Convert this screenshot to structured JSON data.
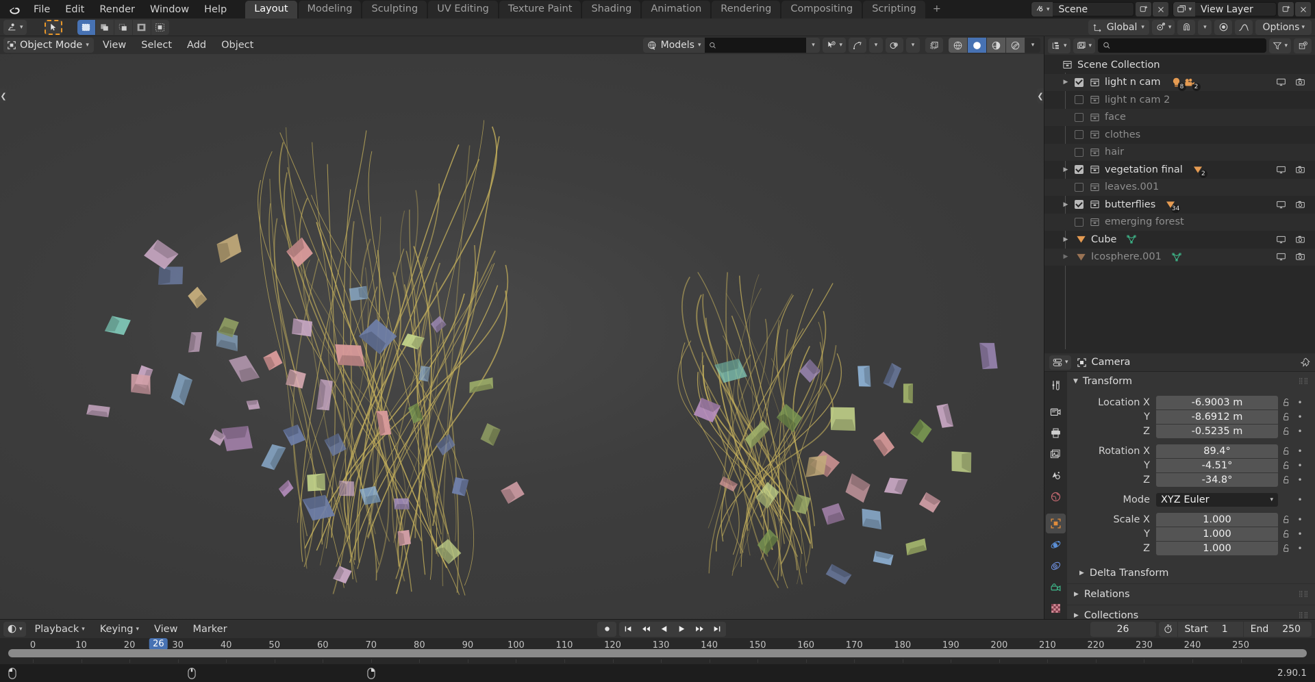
{
  "app": {
    "version": "2.90.1",
    "logo_icon": "blender-logo-icon"
  },
  "topbar": {
    "menus": [
      "File",
      "Edit",
      "Render",
      "Window",
      "Help"
    ],
    "workspace_tabs": [
      {
        "label": "Layout",
        "active": true
      },
      {
        "label": "Modeling",
        "active": false
      },
      {
        "label": "Sculpting",
        "active": false
      },
      {
        "label": "UV Editing",
        "active": false
      },
      {
        "label": "Texture Paint",
        "active": false
      },
      {
        "label": "Shading",
        "active": false
      },
      {
        "label": "Animation",
        "active": false
      },
      {
        "label": "Rendering",
        "active": false
      },
      {
        "label": "Compositing",
        "active": false
      },
      {
        "label": "Scripting",
        "active": false
      }
    ],
    "add_workspace_label": "+",
    "scene_name": "Scene",
    "view_layer_name": "View Layer"
  },
  "toolrow": {
    "transform_orientation": "Global",
    "options_label": "Options",
    "snapping_icon": "magnet-icon",
    "proportional_icon": "proportional-edit-icon",
    "editor_type_icon": "editor-type-icon",
    "cursor_tool_icon": "cursor-tool-icon",
    "select_modes": [
      "set",
      "extend",
      "subtract",
      "invert",
      "intersect"
    ]
  },
  "viewport_header": {
    "mode": "Object Mode",
    "menus": [
      "View",
      "Select",
      "Add",
      "Object"
    ],
    "collection_filter": "Models",
    "search_placeholder": "",
    "visibility_icon": "eye-visibility-icon",
    "gizmo_icon": "gizmo-icon",
    "overlays_icon": "overlays-icon",
    "xray_icon": "xray-toggle-icon",
    "shading_modes": [
      "wireframe",
      "solid",
      "material-preview",
      "rendered"
    ],
    "active_shading": "solid"
  },
  "outliner": {
    "display_mode_icon": "outliner-display-mode-icon",
    "filter_id_icon": "id-type-filter-icon",
    "search_placeholder": "",
    "filter_icon": "funnel-filter-icon",
    "new_collection_icon": "new-collection-icon",
    "root": "Scene Collection",
    "items": [
      {
        "name": "light n cam",
        "type": "collection",
        "checked": true,
        "dim": false,
        "expandable": true,
        "badges": [
          {
            "icon": "light-icon",
            "count": "8"
          },
          {
            "icon": "camera-icon",
            "count": "2"
          }
        ],
        "show_monitor": true,
        "show_camera": true
      },
      {
        "name": "light n cam 2",
        "type": "collection",
        "checked": false,
        "dim": true,
        "expandable": false,
        "badges": [],
        "show_monitor": false,
        "show_camera": false
      },
      {
        "name": "face",
        "type": "collection",
        "checked": false,
        "dim": true,
        "expandable": false,
        "badges": [],
        "show_monitor": false,
        "show_camera": false
      },
      {
        "name": "clothes",
        "type": "collection",
        "checked": false,
        "dim": true,
        "expandable": false,
        "badges": [],
        "show_monitor": false,
        "show_camera": false
      },
      {
        "name": "hair",
        "type": "collection",
        "checked": false,
        "dim": true,
        "expandable": false,
        "badges": [],
        "show_monitor": false,
        "show_camera": false
      },
      {
        "name": "vegetation final",
        "type": "collection",
        "checked": true,
        "dim": false,
        "expandable": true,
        "badges": [
          {
            "icon": "mesh-data-icon",
            "count": "2"
          }
        ],
        "show_monitor": true,
        "show_camera": true
      },
      {
        "name": "leaves.001",
        "type": "collection",
        "checked": false,
        "dim": true,
        "expandable": false,
        "badges": [],
        "show_monitor": false,
        "show_camera": false
      },
      {
        "name": "butterflies",
        "type": "collection",
        "checked": true,
        "dim": false,
        "expandable": true,
        "badges": [
          {
            "icon": "mesh-data-icon",
            "count": "34"
          }
        ],
        "show_monitor": true,
        "show_camera": true
      },
      {
        "name": "emerging forest",
        "type": "collection",
        "checked": false,
        "dim": true,
        "expandable": false,
        "badges": [],
        "show_monitor": false,
        "show_camera": false
      },
      {
        "name": "Cube",
        "type": "object",
        "checked": null,
        "dim": false,
        "expandable": true,
        "badges": [
          {
            "icon": "mesh-data-icon",
            "count": ""
          }
        ],
        "show_monitor": true,
        "show_camera": true
      },
      {
        "name": "Icosphere.001",
        "type": "object",
        "checked": null,
        "dim": true,
        "expandable": true,
        "badges": [
          {
            "icon": "mesh-data-icon",
            "count": ""
          }
        ],
        "show_monitor": true,
        "show_camera": true
      }
    ]
  },
  "properties": {
    "breadcrumb_object": "Camera",
    "pin_icon": "pin-icon",
    "tabs": [
      {
        "name": "tool",
        "icon": "tool-icon",
        "active": false
      },
      {
        "name": "render",
        "icon": "render-camera-icon",
        "active": false
      },
      {
        "name": "output",
        "icon": "printer-output-icon",
        "active": false
      },
      {
        "name": "view-layer",
        "icon": "images-viewlayer-icon",
        "active": false
      },
      {
        "name": "scene",
        "icon": "scene-cone-icon",
        "active": false
      },
      {
        "name": "world",
        "icon": "world-globe-icon",
        "active": false
      },
      {
        "name": "object",
        "icon": "object-square-icon",
        "active": true
      },
      {
        "name": "modifiers",
        "icon": "physics-orbit-icon",
        "active": false
      },
      {
        "name": "physics",
        "icon": "physics-icon",
        "active": false
      },
      {
        "name": "object-data",
        "icon": "camera-data-icon",
        "active": false
      },
      {
        "name": "texture",
        "icon": "checker-texture-icon",
        "active": false
      }
    ],
    "transform_panel": {
      "title": "Transform",
      "location": {
        "label": "Location X",
        "x": "-6.9003 m",
        "y": "-8.6912 m",
        "z": "-0.5235 m"
      },
      "rotation": {
        "label": "Rotation X",
        "x": "89.4°",
        "y": "-4.51°",
        "z": "-34.8°"
      },
      "mode": {
        "label": "Mode",
        "value": "XYZ Euler"
      },
      "scale": {
        "label": "Scale X",
        "x": "1.000",
        "y": "1.000",
        "z": "1.000"
      },
      "axis_y": "Y",
      "axis_z": "Z"
    },
    "delta_transform_label": "Delta Transform",
    "relations_label": "Relations",
    "collections_label": "Collections"
  },
  "timeline": {
    "editor_icon": "timeline-editor-icon",
    "menus": [
      "Playback",
      "Keying",
      "View",
      "Marker"
    ],
    "record_icon": "auto-keying-record-icon",
    "transport": [
      "jump-to-start",
      "prev-keyframe",
      "play-reverse",
      "play",
      "next-keyframe",
      "jump-to-end"
    ],
    "current_frame": "26",
    "timer_icon": "use-preview-range-icon",
    "start_label": "Start",
    "start_value": "1",
    "end_label": "End",
    "end_value": "250",
    "tick_labels": [
      "0",
      "10",
      "20",
      "30",
      "40",
      "50",
      "60",
      "70",
      "80",
      "90",
      "100",
      "110",
      "120",
      "130",
      "140",
      "150",
      "160",
      "170",
      "180",
      "190",
      "200",
      "210",
      "220",
      "230",
      "240",
      "250"
    ],
    "playhead_frame": 26,
    "range_min": 0,
    "range_max": 258
  },
  "statusbar": {
    "version": "2.90.1",
    "hints": [
      "select",
      "menu",
      "context-menu"
    ]
  },
  "colors": {
    "accent_blue": "#4772b3",
    "accent_orange": "#e8972a",
    "collection_orange": "#e59b52",
    "mesh_green": "#4ab384",
    "bg_dark": "#1d1d1d",
    "bg_panel": "#303030",
    "bg_outliner": "#282828",
    "viewport_bg": "#3b3b3b"
  },
  "scene_art": {
    "description": "3D viewport showing two clusters of thin curved golden grass strands with many small colorful butterfly-like quad cards scattered around",
    "strand_color": "#c7b25c",
    "card_palette": [
      "#c9a8c4",
      "#9fb06a",
      "#d89a9a",
      "#8aa8c4",
      "#7ec4b4",
      "#c2aa7a",
      "#a58fc0",
      "#6f7fa8",
      "#7c9a52",
      "#d4a0a8",
      "#b88fc0",
      "#8fb3d6",
      "#e0b0b8",
      "#c4d48a"
    ],
    "clusters": 2
  }
}
